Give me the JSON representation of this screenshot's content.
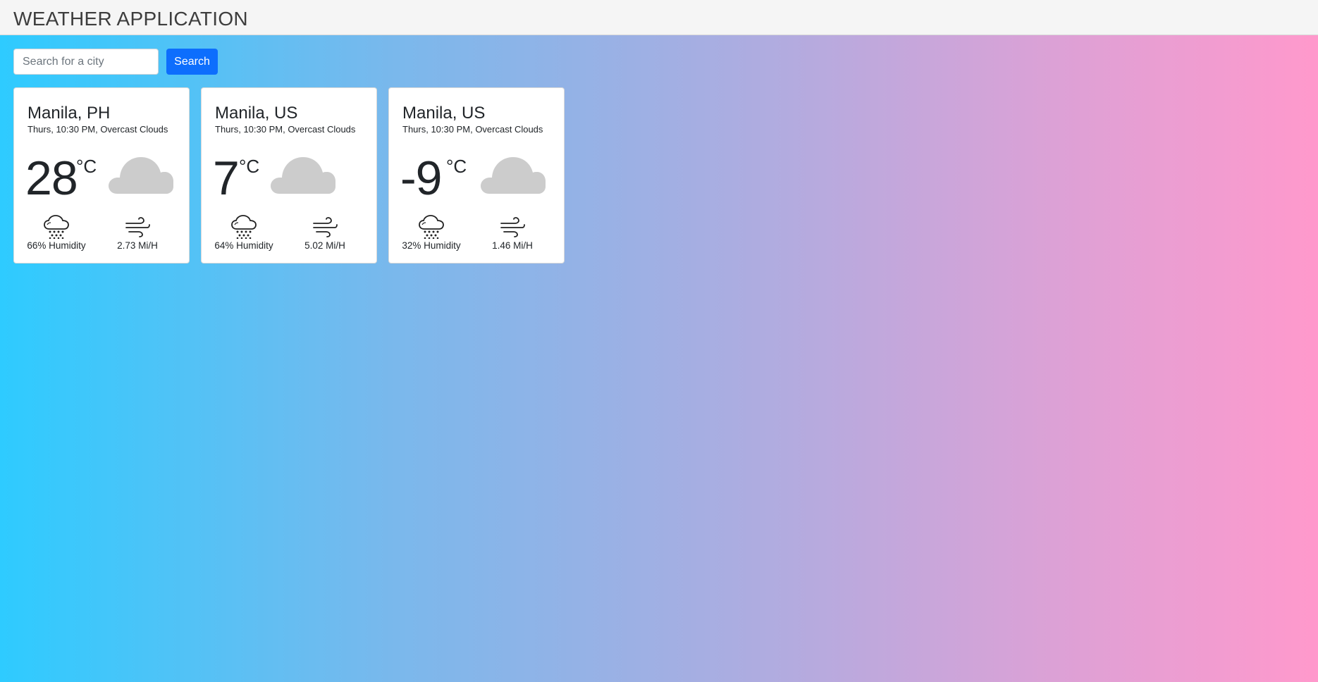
{
  "header": {
    "title": "WEATHER APPLICATION"
  },
  "search": {
    "placeholder": "Search for a city",
    "value": "",
    "button_label": "Search"
  },
  "cards": [
    {
      "city": "Manila, PH",
      "description": "Thurs, 10:30 PM, Overcast Clouds",
      "temperature": "28",
      "unit": "°C",
      "condition_icon": "cloud-icon",
      "humidity": "66% Humidity",
      "wind": "2.73 Mi/H"
    },
    {
      "city": "Manila, US",
      "description": "Thurs, 10:30 PM, Overcast Clouds",
      "temperature": "7",
      "unit": "°C",
      "condition_icon": "cloud-icon",
      "humidity": "64% Humidity",
      "wind": "5.02 Mi/H"
    },
    {
      "city": "Manila, US",
      "description": "Thurs, 10:30 PM, Overcast Clouds",
      "temperature": "-9",
      "unit": "°C",
      "condition_icon": "cloud-icon",
      "humidity": "32% Humidity",
      "wind": "1.46 Mi/H"
    }
  ],
  "colors": {
    "header_bg": "#f5f5f5",
    "accent": "#0d6efd",
    "gradient_start": "#2ecbff",
    "gradient_end": "#ff99cc",
    "cloud": "#cccccc"
  }
}
